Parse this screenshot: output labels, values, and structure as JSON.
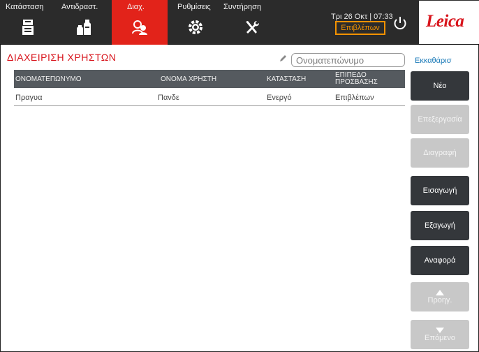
{
  "tabs": [
    {
      "label": "Κατάσταση",
      "icon": "instrument-status-icon",
      "active": false
    },
    {
      "label": "Αντιδραστ.",
      "icon": "reagent-bottles-icon",
      "active": false
    },
    {
      "label": "Διαχ.",
      "icon": "administration-users-icon",
      "active": true
    },
    {
      "label": "Ρυθμίσεις",
      "icon": "settings-gear-icon",
      "active": false
    },
    {
      "label": "Συντήρηση",
      "icon": "maintenance-tools-icon",
      "active": false
    }
  ],
  "header": {
    "clock": "Τρι 26 Οκτ | 07:33",
    "role": "Επιβλέπων",
    "logo": "Leica"
  },
  "page": {
    "title": "ΔΙΑΧΕΙΡΙΣΗ ΧΡΗΣΤΩΝ",
    "search_placeholder": "Ονοματεπώνυμο",
    "clear_label": "Εκκαθάρισ"
  },
  "table": {
    "columns": [
      "ΟΝΟΜΑΤΕΠΩΝΥΜΟ",
      "ΟΝΟΜΑ ΧΡΗΣΤΗ",
      "ΚΑΤΑΣΤΑΣΗ",
      "ΕΠΙΠΕΔΟ ΠΡΟΣΒΑΣΗΣ"
    ],
    "rows": [
      [
        "Πραγυα",
        "Πανδε",
        "Ενεργό",
        "Επιβλέπων"
      ]
    ]
  },
  "actions": {
    "new": "Νέο",
    "edit": "Επεξεργασία",
    "delete": "Διαγραφή",
    "import": "Εισαγωγή",
    "export": "Εξαγωγή",
    "report": "Αναφορά",
    "prev": "Προηγ.",
    "next": "Επόμενο"
  },
  "colors": {
    "accent_red": "#e2231a",
    "role_orange": "#f39200",
    "link_blue": "#1a7ab8",
    "button_dark": "#34373b",
    "button_disabled": "#c8c8c8"
  }
}
